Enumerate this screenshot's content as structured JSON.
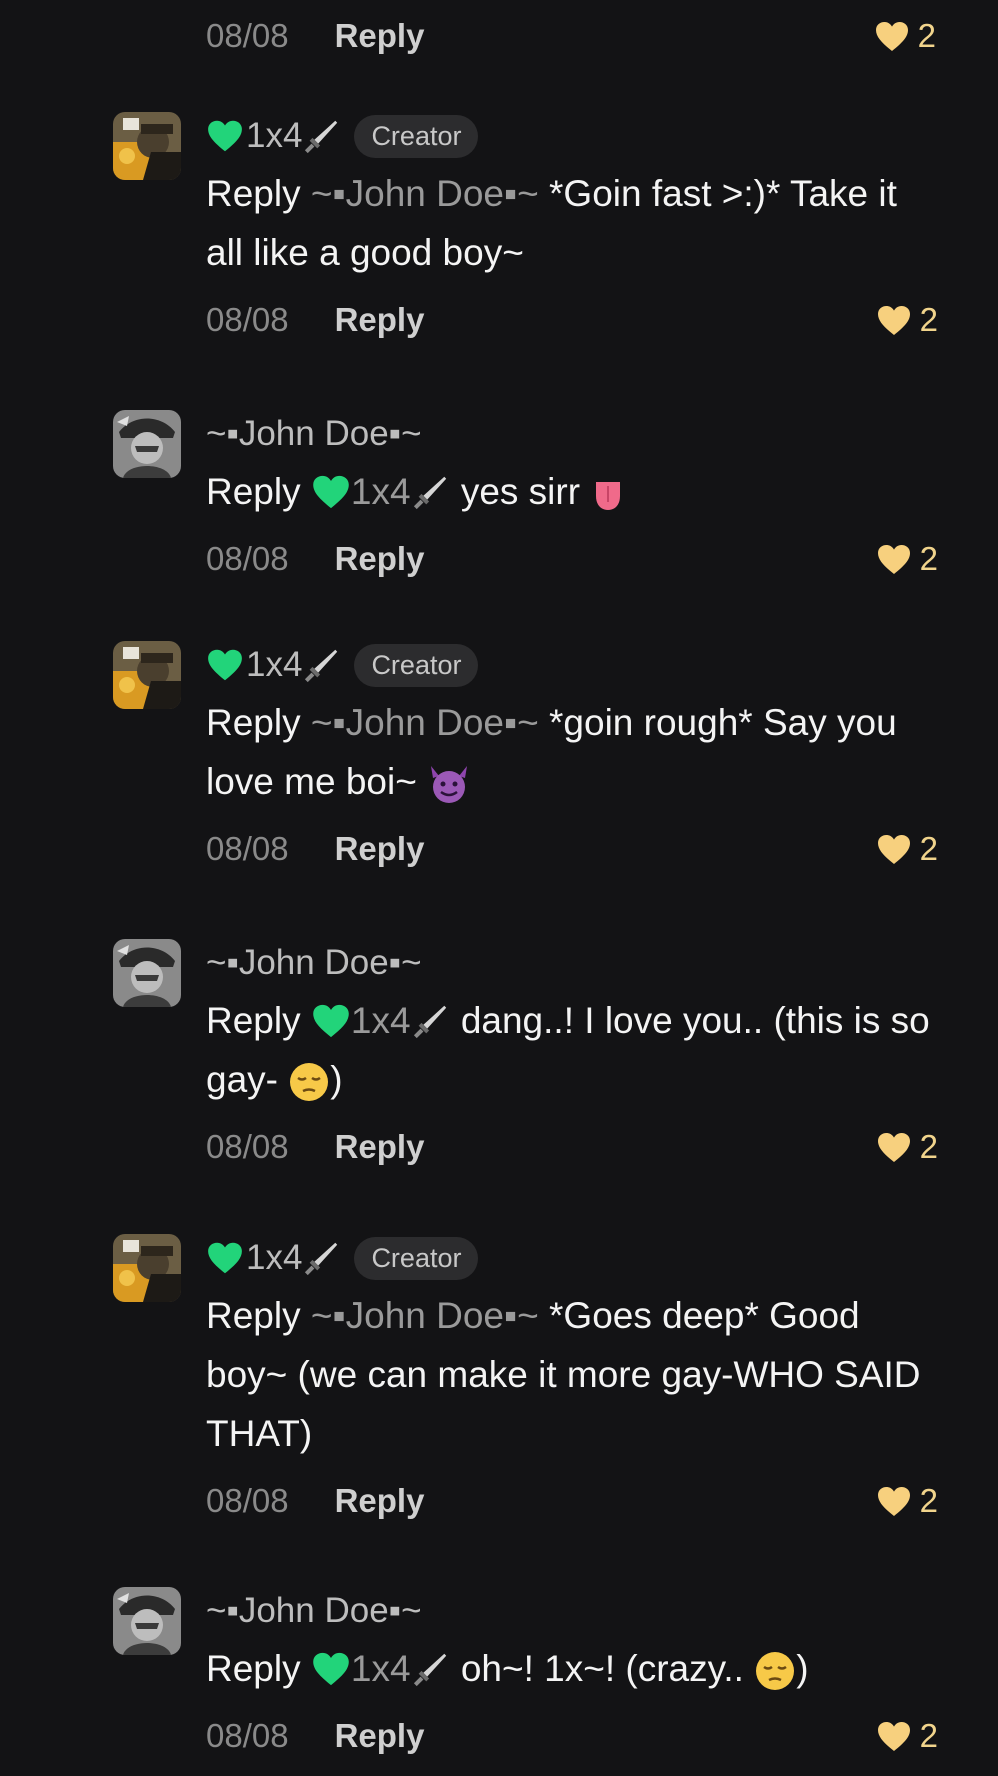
{
  "colors": {
    "background": "#131315",
    "like_heart": "#f7d07e",
    "green_heart": "#22d47a",
    "badge_bg": "#2c2c2e"
  },
  "top_meta": {
    "date": "08/08",
    "reply_label": "Reply",
    "likes": "2"
  },
  "comments": [
    {
      "avatar": "avatar-creator",
      "author": "1x4",
      "author_prefix_icon": "green-heart-icon",
      "author_suffix_icon": "dagger-icon",
      "badge": "Creator",
      "reply_word": "Reply",
      "mention": "~▪John Doe▪~",
      "text": " *Goin fast >:)* Take it all like a good boy~",
      "date": "08/08",
      "reply_label": "Reply",
      "likes": "2"
    },
    {
      "avatar": "avatar-john",
      "author": "~▪John Doe▪~",
      "reply_word": "Reply",
      "mention": "1x4",
      "text": " yes sirr",
      "trailing_emoji": "tongue-emoji",
      "date": "08/08",
      "reply_label": "Reply",
      "likes": "2"
    },
    {
      "avatar": "avatar-creator",
      "author": "1x4",
      "badge": "Creator",
      "reply_word": "Reply",
      "mention": "~▪John Doe▪~",
      "text": " *goin rough* Say you love me boi~",
      "trailing_emoji": "smiling-devil-emoji",
      "date": "08/08",
      "reply_label": "Reply",
      "likes": "2"
    },
    {
      "avatar": "avatar-john",
      "author": "~▪John Doe▪~",
      "reply_word": "Reply",
      "mention": "1x4",
      "text": " dang..!  I love you.. (this is so gay-",
      "trailing_emoji": "pensive-face-emoji",
      "text_after": ")",
      "date": "08/08",
      "reply_label": "Reply",
      "likes": "2"
    },
    {
      "avatar": "avatar-creator",
      "author": "1x4",
      "badge": "Creator",
      "reply_word": "Reply",
      "mention": "~▪John Doe▪~",
      "text": " *Goes deep* Good boy~ (we can make it more gay-WHO SAID THAT)",
      "date": "08/08",
      "reply_label": "Reply",
      "likes": "2"
    },
    {
      "avatar": "avatar-john",
      "author": "~▪John Doe▪~",
      "reply_word": "Reply",
      "mention": "1x4",
      "text": " oh~! 1x~! (crazy..",
      "trailing_emoji": "pensive-face-emoji",
      "text_after": ")",
      "date": "08/08",
      "reply_label": "Reply",
      "likes": "2"
    }
  ]
}
